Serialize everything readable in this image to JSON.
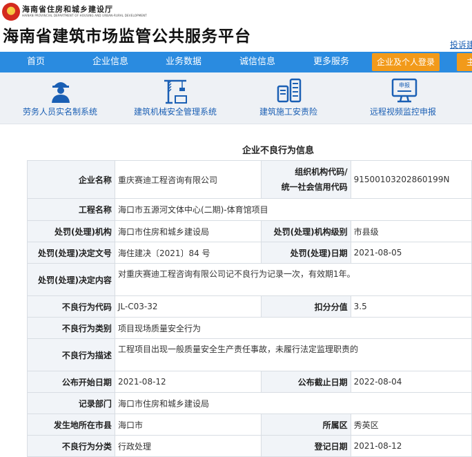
{
  "header": {
    "dept_name": "海南省住房和城乡建设厅",
    "dept_name_en": "HAINAN PROVINCIAL DEPARTMENT OF HOUSING AND URBAN-RURAL DEVELOPMENT",
    "site_title": "海南省建筑市场监管公共服务平台",
    "complaint_link": "投诉建"
  },
  "nav": {
    "items": [
      "首页",
      "企业信息",
      "业务数据",
      "诚信信息",
      "更多服务"
    ],
    "login_label": "企业及个人登录",
    "extra_label": "主"
  },
  "services": [
    {
      "label": "劳务人员实名制系统",
      "icon": "worker-icon"
    },
    {
      "label": "建筑机械安全管理系统",
      "icon": "crane-icon"
    },
    {
      "label": "建筑施工安责险",
      "icon": "insurance-building-icon"
    },
    {
      "label": "远程视频监控申报",
      "icon": "monitor-report-icon"
    }
  ],
  "section_title": "企业不良行为信息",
  "record": {
    "company_name_label": "企业名称",
    "company_name": "重庆赛迪工程咨询有限公司",
    "org_code_label_1": "组织机构代码/",
    "org_code_label_2": "统一社会信用代码",
    "org_code": "91500103202860199N",
    "project_name_label": "工程名称",
    "project_name": "海口市五源河文体中心(二期)-体育馆项目",
    "agency_label": "处罚(处理)机构",
    "agency": "海口市住房和城乡建设局",
    "agency_level_label": "处罚(处理)机构级别",
    "agency_level": "市县级",
    "decision_no_label": "处罚(处理)决定文号",
    "decision_no": "海住建决〔2021〕84 号",
    "decision_date_label": "处罚(处理)日期",
    "decision_date": "2021-08-05",
    "decision_content_label": "处罚(处理)决定内容",
    "decision_content": "对重庆赛迪工程咨询有限公司记不良行为记录一次，有效期1年。",
    "behavior_code_label": "不良行为代码",
    "behavior_code": "JL-C03-32",
    "score_label": "扣分分值",
    "score": "3.5",
    "behavior_type_label": "不良行为类别",
    "behavior_type": "项目现场质量安全行为",
    "behavior_desc_label": "不良行为描述",
    "behavior_desc": "工程项目出现一般质量安全生产责任事故，未履行法定监理职责的",
    "publish_start_label": "公布开始日期",
    "publish_start": "2021-08-12",
    "publish_end_label": "公布截止日期",
    "publish_end": "2022-08-04",
    "record_dept_label": "记录部门",
    "record_dept": "海口市住房和城乡建设局",
    "city_label": "发生地所在市县",
    "city": "海口市",
    "district_label": "所属区",
    "district": "秀英区",
    "category_label": "不良行为分类",
    "category": "行政处理",
    "register_date_label": "登记日期",
    "register_date": "2021-08-12"
  },
  "colors": {
    "nav_blue": "#2a8be0",
    "login_orange": "#f29a1a",
    "link_blue": "#1a5fb4"
  }
}
